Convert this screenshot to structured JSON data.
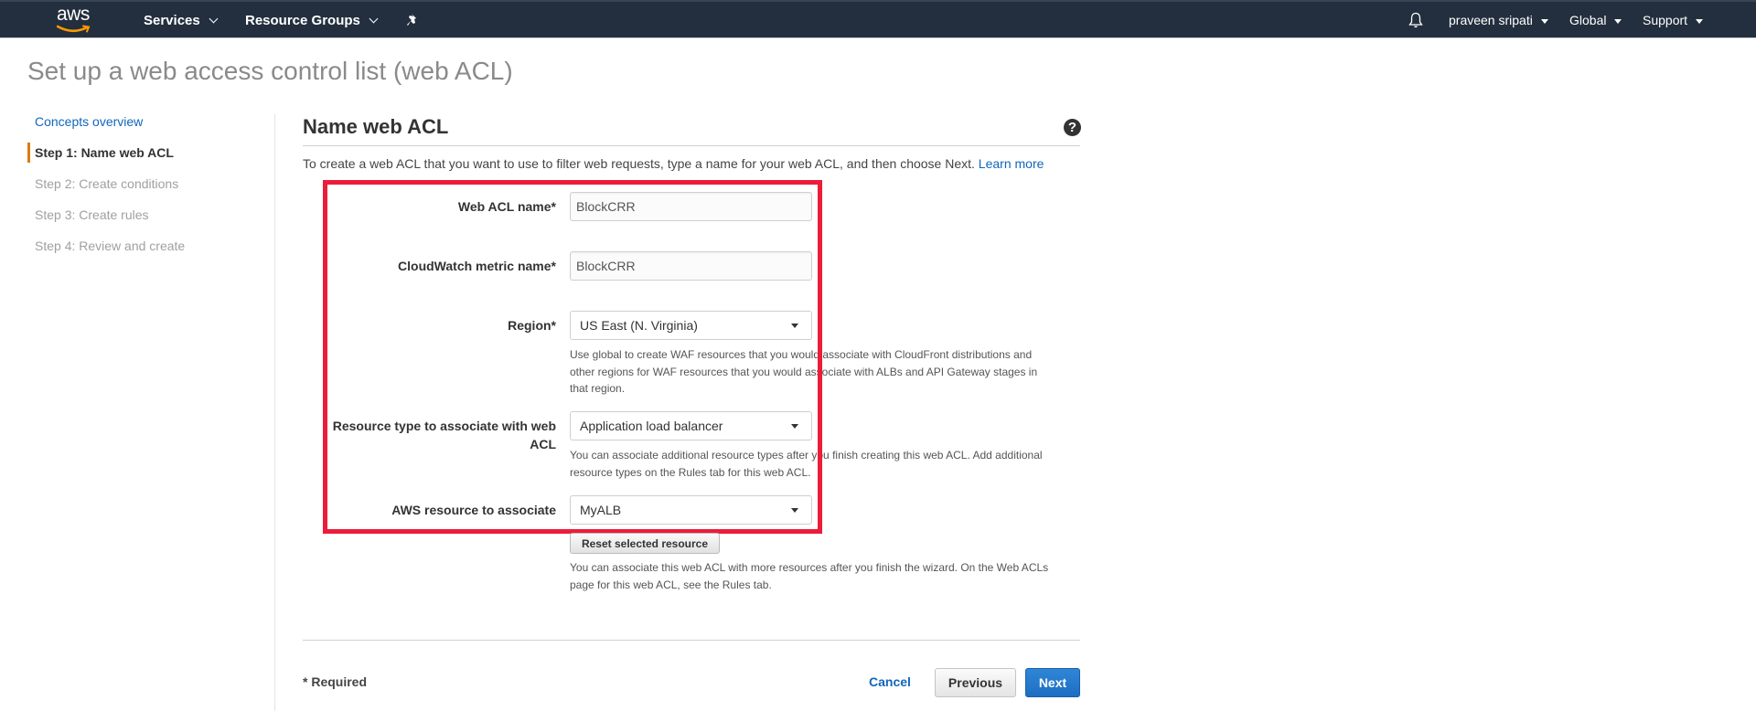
{
  "topnav": {
    "logo_text": "aws",
    "services_label": "Services",
    "resource_groups_label": "Resource Groups",
    "user_label": "praveen sripati",
    "region_label": "Global",
    "support_label": "Support",
    "colors": {
      "background": "#232f3e",
      "logo_smile": "#ff9900"
    }
  },
  "page": {
    "title": "Set up a web access control list (web ACL)"
  },
  "wizard_nav": {
    "concepts_link": "Concepts overview",
    "steps": [
      {
        "label": "Step 1: Name web ACL",
        "state": "active"
      },
      {
        "label": "Step 2: Create conditions",
        "state": "inactive"
      },
      {
        "label": "Step 3: Create rules",
        "state": "inactive"
      },
      {
        "label": "Step 4: Review and create",
        "state": "inactive"
      }
    ],
    "active_marker_color": "#e07b00"
  },
  "panel": {
    "title": "Name web ACL",
    "help_icon": "?",
    "description": "To create a web ACL that you want to use to filter web requests, type a name for your web ACL, and then choose Next.",
    "learn_more": "Learn more"
  },
  "form": {
    "highlight_color": "#ec1c3a",
    "web_acl_name": {
      "label": "Web ACL name*",
      "value": "BlockCRR"
    },
    "metric_name": {
      "label": "CloudWatch metric name*",
      "value": "BlockCRR"
    },
    "region": {
      "label": "Region*",
      "value": "US East (N. Virginia)",
      "help_line1": "Use global to create WAF resources that you would associate with CloudFront distributions and",
      "help_line2": "other regions for WAF resources that you would associate with ALBs and API Gateway stages in",
      "help_line3": "that region."
    },
    "resource_type": {
      "label_line1": "Resource type to associate with web",
      "label_line2": "ACL",
      "value": "Application load balancer",
      "help_line1": "You can associate additional resource types after you finish creating this web ACL. Add additional",
      "help_line2": "resource types on the Rules tab for this web ACL."
    },
    "aws_resource": {
      "label": "AWS resource to associate",
      "value": "MyALB"
    },
    "reset_button": "Reset selected resource",
    "reset_help_line1": "You can associate this web ACL with more resources after you finish the wizard. On the Web ACLs",
    "reset_help_line2": "page for this web ACL, see the Rules tab."
  },
  "footer": {
    "required_note": "* Required",
    "cancel": "Cancel",
    "previous": "Previous",
    "next": "Next"
  }
}
